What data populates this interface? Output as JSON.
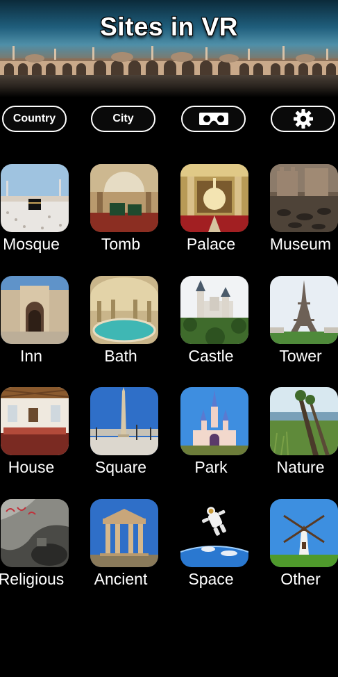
{
  "header": {
    "title": "Sites in VR"
  },
  "toolbar": {
    "country_label": "Country",
    "city_label": "City",
    "vr_icon": "vr-headset-icon",
    "settings_icon": "gear-icon"
  },
  "categories": [
    {
      "label": "Mosque"
    },
    {
      "label": "Tomb"
    },
    {
      "label": "Palace"
    },
    {
      "label": "Museum"
    },
    {
      "label": "Inn"
    },
    {
      "label": "Bath"
    },
    {
      "label": "Castle"
    },
    {
      "label": "Tower"
    },
    {
      "label": "House"
    },
    {
      "label": "Square"
    },
    {
      "label": "Park"
    },
    {
      "label": "Nature"
    },
    {
      "label": "Religious"
    },
    {
      "label": "Ancient"
    },
    {
      "label": "Space"
    },
    {
      "label": "Other"
    }
  ]
}
